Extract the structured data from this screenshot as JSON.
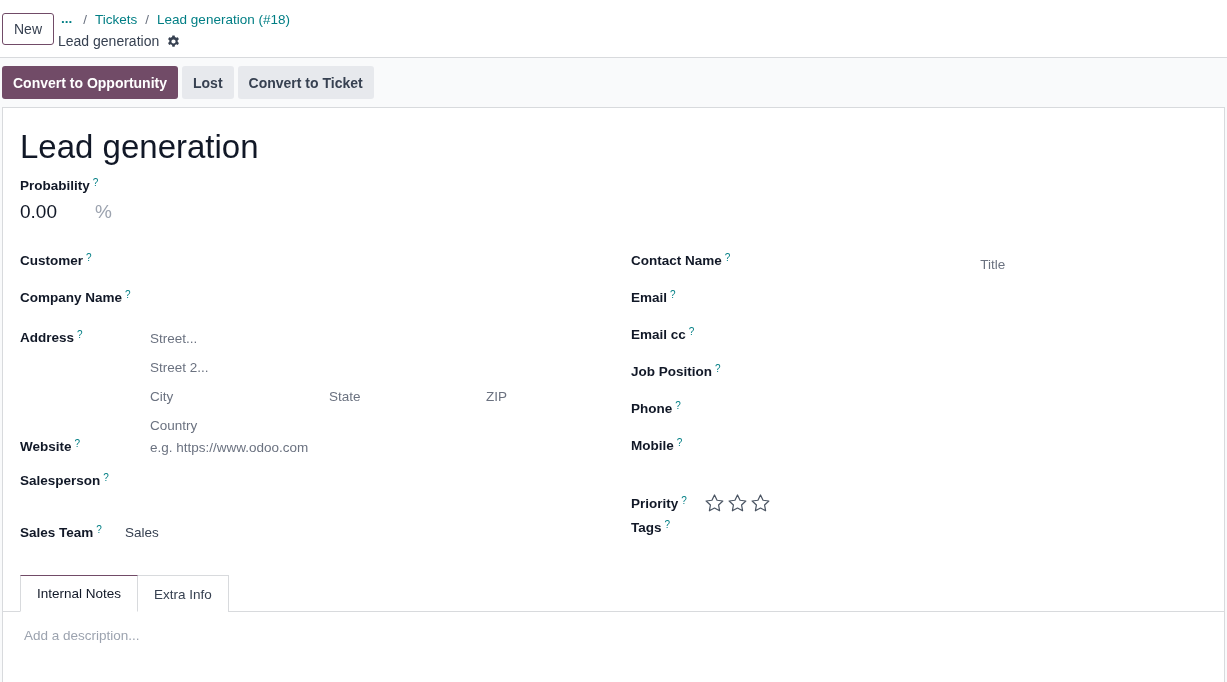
{
  "control_panel": {
    "new_button": "New",
    "breadcrumbs": [
      {
        "label": "...",
        "kind": "more"
      },
      {
        "label": "Tickets",
        "kind": "link",
        "separator": "/"
      },
      {
        "label": "Lead generation (#18)",
        "kind": "link",
        "separator": "/"
      }
    ],
    "record_name": "Lead generation"
  },
  "actions": [
    {
      "label": "Convert to Opportunity",
      "kind": "primary"
    },
    {
      "label": "Lost",
      "kind": "secondary"
    },
    {
      "label": "Convert to Ticket",
      "kind": "secondary"
    }
  ],
  "form": {
    "title": "Lead generation",
    "probability": {
      "label": "Probability",
      "help": "?",
      "value": "0.00",
      "unit": "%"
    },
    "left_fields": [
      {
        "label": "Customer",
        "help": "?",
        "kind": "empty"
      },
      {
        "label": "Company Name",
        "help": "?",
        "kind": "empty"
      },
      {
        "label": "Address",
        "help": "?",
        "kind": "address",
        "lines": [
          [
            {
              "placeholder": "Street..."
            }
          ],
          [
            {
              "placeholder": "Street 2..."
            }
          ],
          [
            {
              "placeholder": "City"
            },
            {
              "placeholder": "State"
            },
            {
              "placeholder": "ZIP"
            }
          ],
          [
            {
              "placeholder": "Country"
            }
          ]
        ]
      },
      {
        "label": "Website",
        "help": "?",
        "kind": "input",
        "placeholder": "e.g. https://www.odoo.com"
      },
      {
        "label": "Salesperson",
        "help": "?",
        "kind": "empty"
      },
      {
        "label": "Sales Team",
        "help": "?",
        "kind": "value",
        "value": "Sales"
      }
    ],
    "right_fields": [
      {
        "label": "Contact Name",
        "help": "?",
        "kind": "contact",
        "title_placeholder": "Title"
      },
      {
        "label": "Email",
        "help": "?",
        "kind": "empty"
      },
      {
        "label": "Email cc",
        "help": "?",
        "kind": "empty"
      },
      {
        "label": "Job Position",
        "help": "?",
        "kind": "empty"
      },
      {
        "label": "Phone",
        "help": "?",
        "kind": "empty"
      },
      {
        "label": "Mobile",
        "help": "?",
        "kind": "empty"
      },
      {
        "label": "Priority",
        "help": "?",
        "kind": "stars",
        "stars": 0
      },
      {
        "label": "Tags",
        "help": "?",
        "kind": "empty"
      }
    ],
    "tabs": [
      {
        "label": "Internal Notes",
        "selected": true
      },
      {
        "label": "Extra Info",
        "selected": false
      }
    ],
    "description": {
      "placeholder": "Add a description..."
    }
  }
}
